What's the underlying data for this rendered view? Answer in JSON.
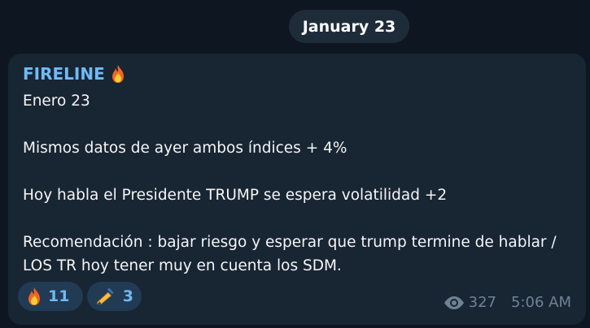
{
  "date_separator": "January 23",
  "message": {
    "sender": "FIRELINE",
    "sender_icon": "fire-icon",
    "text": "Enero 23\n\nMismos datos de ayer ambos índices  + 4%\n\nHoy habla el Presidente TRUMP se espera volatilidad +2\n\nRecomendación : bajar riesgo y esperar que trump termine de hablar / LOS TR hoy tener muy en cuenta los SDM.",
    "reactions": [
      {
        "icon": "fire-icon",
        "count": "11"
      },
      {
        "icon": "writing-hand-icon",
        "count": "3"
      }
    ],
    "views": "327",
    "time": "5:06 AM"
  },
  "colors": {
    "background": "#0e1621",
    "bubble": "#182533",
    "accent": "#71baf5",
    "reaction_bg": "#223b55",
    "meta": "#6f8295"
  }
}
